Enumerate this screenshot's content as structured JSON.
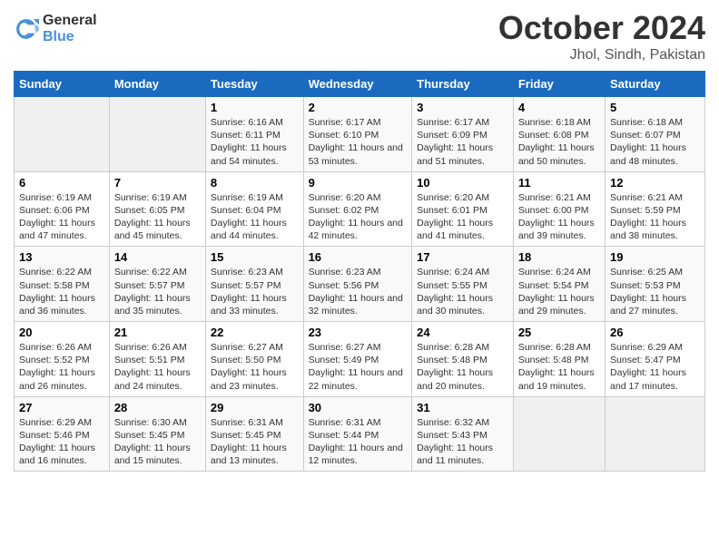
{
  "logo": {
    "general": "General",
    "blue": "Blue"
  },
  "title": "October 2024",
  "subtitle": "Jhol, Sindh, Pakistan",
  "days_of_week": [
    "Sunday",
    "Monday",
    "Tuesday",
    "Wednesday",
    "Thursday",
    "Friday",
    "Saturday"
  ],
  "weeks": [
    [
      {
        "day": null
      },
      {
        "day": null
      },
      {
        "day": "1",
        "sunrise": "Sunrise: 6:16 AM",
        "sunset": "Sunset: 6:11 PM",
        "daylight": "Daylight: 11 hours and 54 minutes."
      },
      {
        "day": "2",
        "sunrise": "Sunrise: 6:17 AM",
        "sunset": "Sunset: 6:10 PM",
        "daylight": "Daylight: 11 hours and 53 minutes."
      },
      {
        "day": "3",
        "sunrise": "Sunrise: 6:17 AM",
        "sunset": "Sunset: 6:09 PM",
        "daylight": "Daylight: 11 hours and 51 minutes."
      },
      {
        "day": "4",
        "sunrise": "Sunrise: 6:18 AM",
        "sunset": "Sunset: 6:08 PM",
        "daylight": "Daylight: 11 hours and 50 minutes."
      },
      {
        "day": "5",
        "sunrise": "Sunrise: 6:18 AM",
        "sunset": "Sunset: 6:07 PM",
        "daylight": "Daylight: 11 hours and 48 minutes."
      }
    ],
    [
      {
        "day": "6",
        "sunrise": "Sunrise: 6:19 AM",
        "sunset": "Sunset: 6:06 PM",
        "daylight": "Daylight: 11 hours and 47 minutes."
      },
      {
        "day": "7",
        "sunrise": "Sunrise: 6:19 AM",
        "sunset": "Sunset: 6:05 PM",
        "daylight": "Daylight: 11 hours and 45 minutes."
      },
      {
        "day": "8",
        "sunrise": "Sunrise: 6:19 AM",
        "sunset": "Sunset: 6:04 PM",
        "daylight": "Daylight: 11 hours and 44 minutes."
      },
      {
        "day": "9",
        "sunrise": "Sunrise: 6:20 AM",
        "sunset": "Sunset: 6:02 PM",
        "daylight": "Daylight: 11 hours and 42 minutes."
      },
      {
        "day": "10",
        "sunrise": "Sunrise: 6:20 AM",
        "sunset": "Sunset: 6:01 PM",
        "daylight": "Daylight: 11 hours and 41 minutes."
      },
      {
        "day": "11",
        "sunrise": "Sunrise: 6:21 AM",
        "sunset": "Sunset: 6:00 PM",
        "daylight": "Daylight: 11 hours and 39 minutes."
      },
      {
        "day": "12",
        "sunrise": "Sunrise: 6:21 AM",
        "sunset": "Sunset: 5:59 PM",
        "daylight": "Daylight: 11 hours and 38 minutes."
      }
    ],
    [
      {
        "day": "13",
        "sunrise": "Sunrise: 6:22 AM",
        "sunset": "Sunset: 5:58 PM",
        "daylight": "Daylight: 11 hours and 36 minutes."
      },
      {
        "day": "14",
        "sunrise": "Sunrise: 6:22 AM",
        "sunset": "Sunset: 5:57 PM",
        "daylight": "Daylight: 11 hours and 35 minutes."
      },
      {
        "day": "15",
        "sunrise": "Sunrise: 6:23 AM",
        "sunset": "Sunset: 5:57 PM",
        "daylight": "Daylight: 11 hours and 33 minutes."
      },
      {
        "day": "16",
        "sunrise": "Sunrise: 6:23 AM",
        "sunset": "Sunset: 5:56 PM",
        "daylight": "Daylight: 11 hours and 32 minutes."
      },
      {
        "day": "17",
        "sunrise": "Sunrise: 6:24 AM",
        "sunset": "Sunset: 5:55 PM",
        "daylight": "Daylight: 11 hours and 30 minutes."
      },
      {
        "day": "18",
        "sunrise": "Sunrise: 6:24 AM",
        "sunset": "Sunset: 5:54 PM",
        "daylight": "Daylight: 11 hours and 29 minutes."
      },
      {
        "day": "19",
        "sunrise": "Sunrise: 6:25 AM",
        "sunset": "Sunset: 5:53 PM",
        "daylight": "Daylight: 11 hours and 27 minutes."
      }
    ],
    [
      {
        "day": "20",
        "sunrise": "Sunrise: 6:26 AM",
        "sunset": "Sunset: 5:52 PM",
        "daylight": "Daylight: 11 hours and 26 minutes."
      },
      {
        "day": "21",
        "sunrise": "Sunrise: 6:26 AM",
        "sunset": "Sunset: 5:51 PM",
        "daylight": "Daylight: 11 hours and 24 minutes."
      },
      {
        "day": "22",
        "sunrise": "Sunrise: 6:27 AM",
        "sunset": "Sunset: 5:50 PM",
        "daylight": "Daylight: 11 hours and 23 minutes."
      },
      {
        "day": "23",
        "sunrise": "Sunrise: 6:27 AM",
        "sunset": "Sunset: 5:49 PM",
        "daylight": "Daylight: 11 hours and 22 minutes."
      },
      {
        "day": "24",
        "sunrise": "Sunrise: 6:28 AM",
        "sunset": "Sunset: 5:48 PM",
        "daylight": "Daylight: 11 hours and 20 minutes."
      },
      {
        "day": "25",
        "sunrise": "Sunrise: 6:28 AM",
        "sunset": "Sunset: 5:48 PM",
        "daylight": "Daylight: 11 hours and 19 minutes."
      },
      {
        "day": "26",
        "sunrise": "Sunrise: 6:29 AM",
        "sunset": "Sunset: 5:47 PM",
        "daylight": "Daylight: 11 hours and 17 minutes."
      }
    ],
    [
      {
        "day": "27",
        "sunrise": "Sunrise: 6:29 AM",
        "sunset": "Sunset: 5:46 PM",
        "daylight": "Daylight: 11 hours and 16 minutes."
      },
      {
        "day": "28",
        "sunrise": "Sunrise: 6:30 AM",
        "sunset": "Sunset: 5:45 PM",
        "daylight": "Daylight: 11 hours and 15 minutes."
      },
      {
        "day": "29",
        "sunrise": "Sunrise: 6:31 AM",
        "sunset": "Sunset: 5:45 PM",
        "daylight": "Daylight: 11 hours and 13 minutes."
      },
      {
        "day": "30",
        "sunrise": "Sunrise: 6:31 AM",
        "sunset": "Sunset: 5:44 PM",
        "daylight": "Daylight: 11 hours and 12 minutes."
      },
      {
        "day": "31",
        "sunrise": "Sunrise: 6:32 AM",
        "sunset": "Sunset: 5:43 PM",
        "daylight": "Daylight: 11 hours and 11 minutes."
      },
      {
        "day": null
      },
      {
        "day": null
      }
    ]
  ]
}
